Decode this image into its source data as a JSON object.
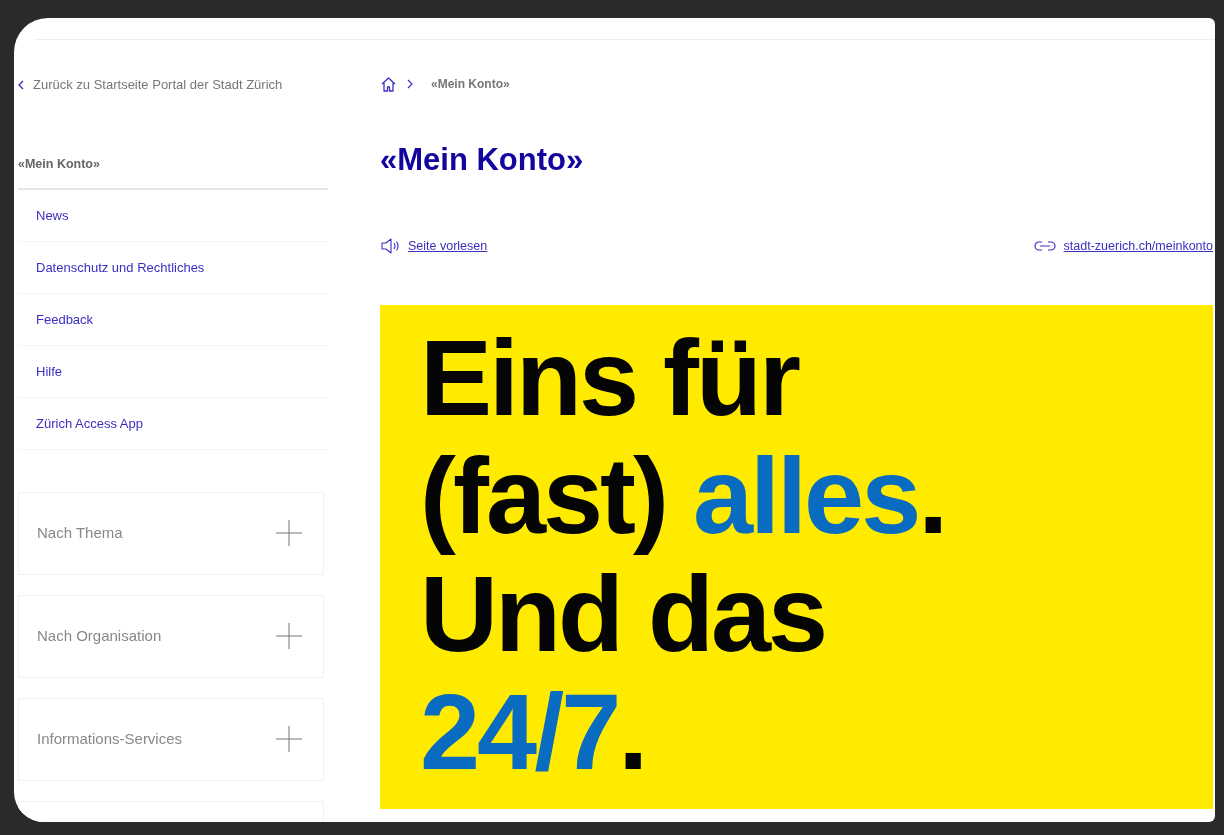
{
  "back_link": {
    "text": "Zurück zu Startseite Portal der Stadt Zürich"
  },
  "sidebar": {
    "heading": "«Mein Konto»",
    "items": [
      {
        "label": "News"
      },
      {
        "label": "Datenschutz und Rechtliches"
      },
      {
        "label": "Feedback"
      },
      {
        "label": "Hilfe"
      },
      {
        "label": "Zürich Access App"
      }
    ],
    "accordions": [
      {
        "label": "Nach Thema",
        "expanded": false
      },
      {
        "label": "Nach Organisation",
        "expanded": false
      },
      {
        "label": "Informations-Services",
        "expanded": false
      }
    ]
  },
  "breadcrumb": [
    {
      "label": "«Mein Konto»"
    }
  ],
  "page_title": "«Mein Konto»",
  "actions": [
    {
      "kind": "read-aloud",
      "label": "Seite vorlesen"
    },
    {
      "kind": "link",
      "label": "stadt-zuerich.ch/meinkonto"
    }
  ],
  "banner": {
    "lines": [
      [
        {
          "text": "Eins für",
          "accent": false
        }
      ],
      [
        {
          "text": "(fast) ",
          "accent": false
        },
        {
          "text": "alles",
          "accent": true
        },
        {
          "text": ".",
          "accent": false
        }
      ],
      [
        {
          "text": "Und das",
          "accent": false
        }
      ],
      [
        {
          "text": "24/7",
          "accent": true
        },
        {
          "text": ".",
          "accent": false
        }
      ]
    ]
  }
}
